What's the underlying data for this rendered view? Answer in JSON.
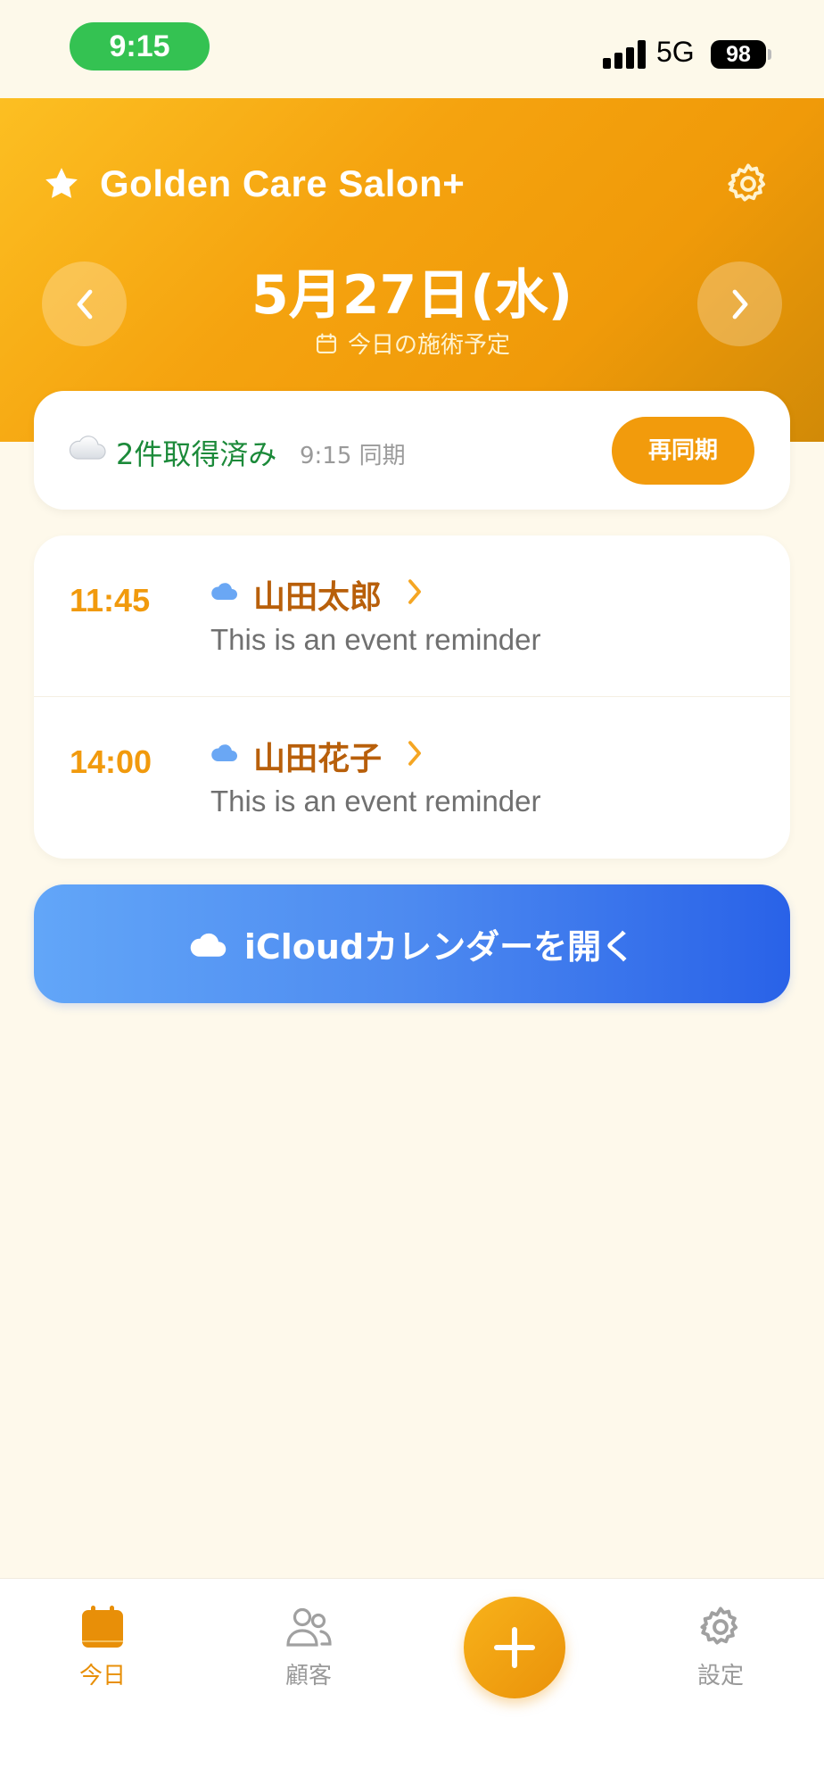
{
  "status_bar": {
    "time": "9:15",
    "network": "5G",
    "battery": "98"
  },
  "header": {
    "app_title": "Golden Care Salon+",
    "date": "5月27日(水)",
    "subtitle": "今日の施術予定",
    "icons": {
      "title": "star-icon",
      "settings": "gear-icon",
      "prev": "chevron-left-icon",
      "next": "chevron-right-icon",
      "subtitle": "calendar-icon"
    }
  },
  "sync": {
    "count_text": "2件取得済み",
    "time_text": "9:15 同期",
    "resync_label": "再同期",
    "icon": "cloud-icon"
  },
  "events": [
    {
      "time": "11:45",
      "name": "山田太郎",
      "description": "This is an event reminder",
      "icon": "cloud-icon"
    },
    {
      "time": "14:00",
      "name": "山田花子",
      "description": "This is an event reminder",
      "icon": "cloud-icon"
    }
  ],
  "icloud_button": {
    "label": "iCloudカレンダーを開く",
    "icon": "cloud-icon"
  },
  "tab_bar": {
    "tabs": [
      {
        "label": "今日",
        "icon": "calendar-icon",
        "active": true
      },
      {
        "label": "顧客",
        "icon": "users-icon",
        "active": false
      },
      {
        "label": "設定",
        "icon": "gear-icon",
        "active": false
      }
    ],
    "fab_icon": "plus-icon"
  },
  "colors": {
    "accent": "#f29b0c",
    "header_gradient": [
      "#fcbf22",
      "#d18a07"
    ],
    "sync_green": "#1c8a3a",
    "event_name": "#b85f0a",
    "icloud_gradient": [
      "#62a6f8",
      "#2962e8"
    ],
    "background": "#fef9eb"
  }
}
